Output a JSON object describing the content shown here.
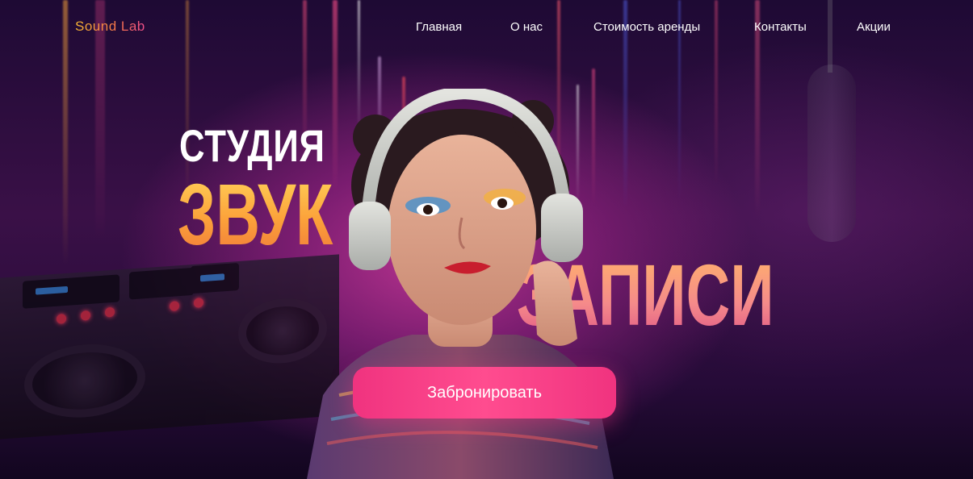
{
  "brand": {
    "logo_text": "Sound Lab"
  },
  "nav": {
    "items": [
      {
        "label": "Главная"
      },
      {
        "label": "О нас"
      },
      {
        "label": "Стоимость аренды"
      },
      {
        "label": "Контакты"
      },
      {
        "label": "Акции"
      }
    ]
  },
  "hero": {
    "line1": "СТУДИЯ",
    "line2": "ЗВУК",
    "line3": "ЗАПИСИ",
    "cta_label": "Забронировать"
  },
  "colors": {
    "accent_pink": "#f0337f",
    "gradient_gold": "#fca23a",
    "background": "#2a0c3d"
  }
}
